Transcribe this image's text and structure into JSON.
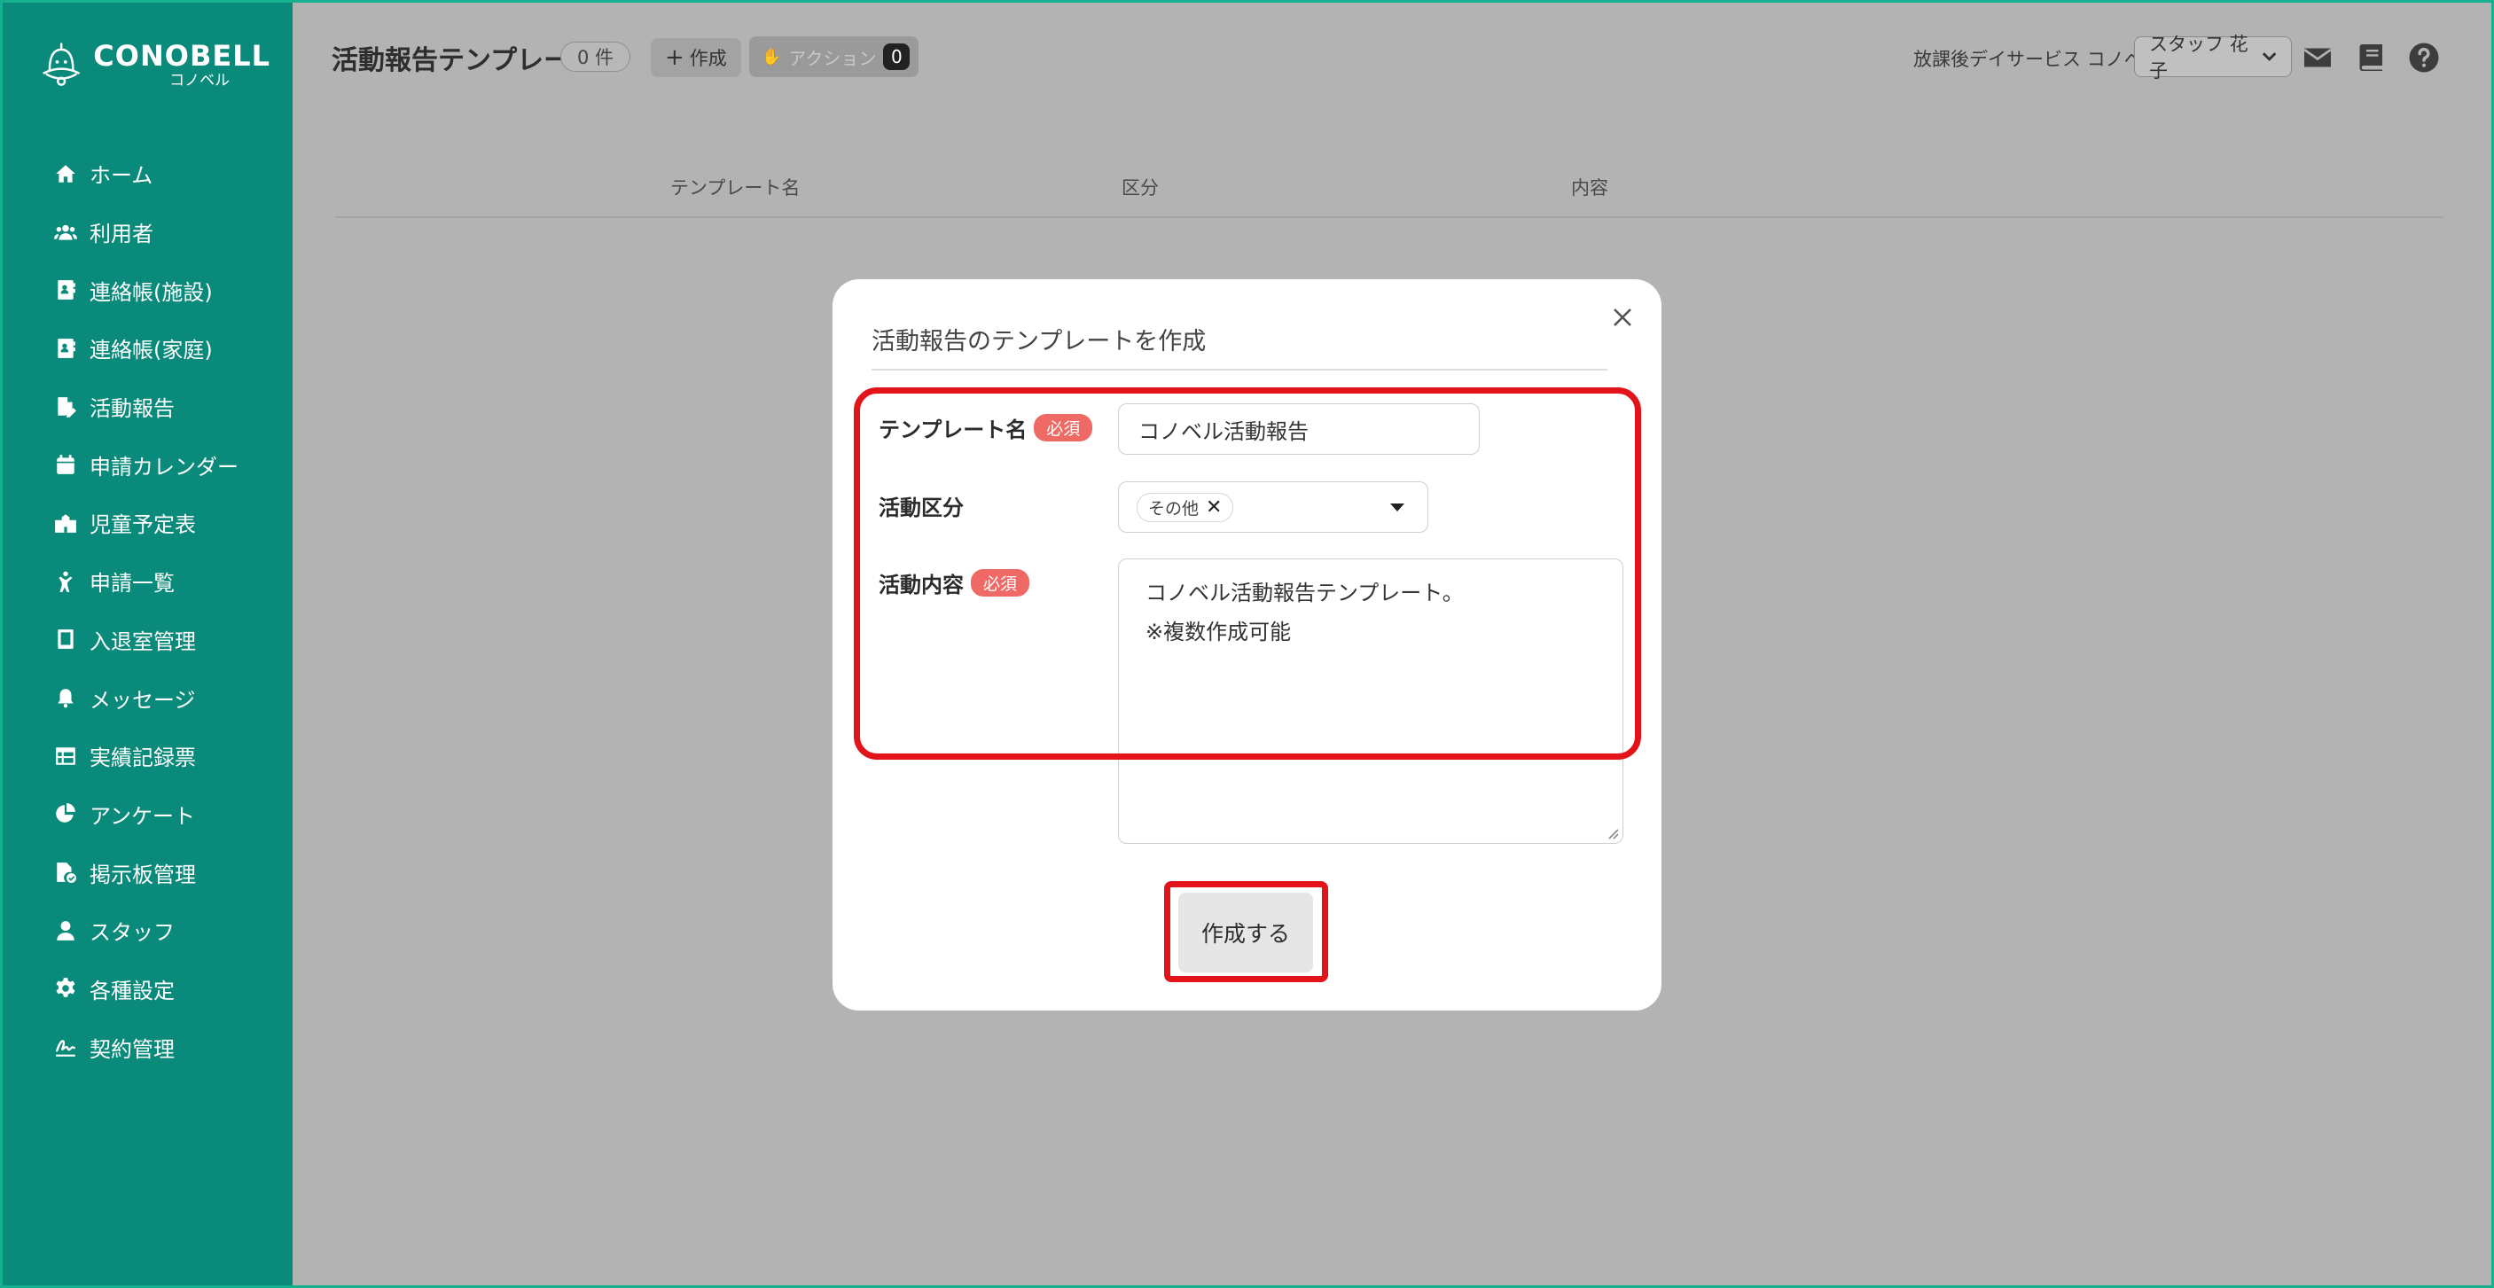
{
  "brand": {
    "name": "CONOBELL",
    "sub": "コノベル"
  },
  "sidebar": {
    "items": [
      {
        "label": "ホーム",
        "icon": "home-icon"
      },
      {
        "label": "利用者",
        "icon": "users-icon"
      },
      {
        "label": "連絡帳(施設)",
        "icon": "contact-book-icon"
      },
      {
        "label": "連絡帳(家庭)",
        "icon": "contact-book-icon"
      },
      {
        "label": "活動報告",
        "icon": "report-icon"
      },
      {
        "label": "申請カレンダー",
        "icon": "calendar-icon"
      },
      {
        "label": "児童予定表",
        "icon": "school-icon"
      },
      {
        "label": "申請一覧",
        "icon": "child-icon"
      },
      {
        "label": "入退室管理",
        "icon": "tablet-icon"
      },
      {
        "label": "メッセージ",
        "icon": "bell-icon"
      },
      {
        "label": "実績記録票",
        "icon": "table-icon"
      },
      {
        "label": "アンケート",
        "icon": "pie-chart-icon"
      },
      {
        "label": "掲示板管理",
        "icon": "file-check-icon"
      },
      {
        "label": "スタッフ",
        "icon": "staff-icon"
      },
      {
        "label": "各種設定",
        "icon": "gear-icon"
      },
      {
        "label": "契約管理",
        "icon": "signature-icon"
      }
    ]
  },
  "header": {
    "title": "活動報告テンプレート",
    "count": "0 件",
    "create_label": "作成",
    "action_label": "アクション",
    "action_count": "0",
    "facility": "放課後デイサービス コノベル",
    "staff": "スタッフ 花子"
  },
  "table": {
    "columns": [
      "テンプレート名",
      "区分",
      "内容"
    ]
  },
  "modal": {
    "title": "活動報告のテンプレートを作成",
    "fields": {
      "template_name_label": "テンプレート名",
      "required": "必須",
      "template_name_value": "コノベル活動報告",
      "category_label": "活動区分",
      "category_chip": "その他",
      "content_label": "活動内容",
      "content_line1": "コノベル活動報告テンプレート。",
      "content_line2": "※複数作成可能"
    },
    "submit_label": "作成する"
  },
  "colors": {
    "sidebar": "#0a8a7a",
    "highlight": "#e2141a",
    "required": "#ef6a64"
  }
}
